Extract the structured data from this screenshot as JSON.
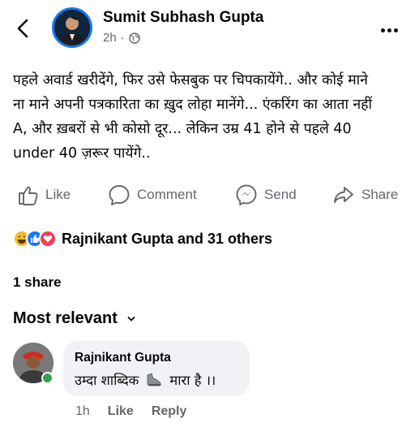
{
  "post": {
    "author": "Sumit Subhash Gupta",
    "time": "2h",
    "separator": "·",
    "privacy_icon": "globe-icon",
    "text": "पहले अवार्ड खरीदेंगे, फिर उसे फेसबुक पर चिपकायेंगे.. और कोई माने\nना माने अपनी पत्रकारिता का ख़ुद लोहा मानेंगे... एंकरिंग का आता नहीं\nA, और ख़बरों से भी कोसो दूर... लेकिन उम्र 41 होने से पहले 40\nunder 40 ज़रूर पायेंगे.."
  },
  "actions": {
    "like": "Like",
    "comment": "Comment",
    "send": "Send",
    "share": "Share"
  },
  "reactions": {
    "icons": [
      "haha-reaction-icon",
      "like-reaction-icon",
      "love-reaction-icon"
    ],
    "summary": "Rajnikant Gupta and 31 others"
  },
  "shares": "1 share",
  "comments": {
    "sort_label": "Most relevant",
    "items": [
      {
        "author": "Rajnikant Gupta",
        "text": "उम्दा शाब्दिक",
        "emoji_icon": "shoe-icon",
        "text_after": "मारा है ।।",
        "time": "1h",
        "like": "Like",
        "reply": "Reply"
      }
    ]
  },
  "colors": {
    "accent": "#1877f2",
    "secondary_text": "#65676b",
    "bubble": "#f0f2f5",
    "online": "#31a24c",
    "love": "#f33e58"
  }
}
